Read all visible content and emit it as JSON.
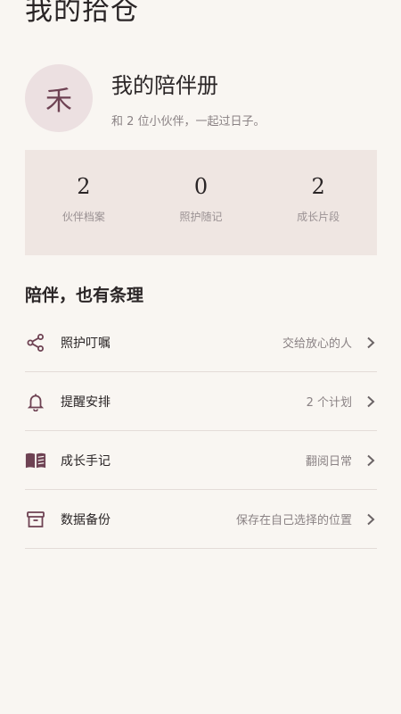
{
  "page": {
    "title": "我的拾仓"
  },
  "profile": {
    "avatar_char": "禾",
    "name": "我的陪伴册",
    "subtitle": "和 2 位小伙伴，一起过日子。"
  },
  "stats": [
    {
      "value": "2",
      "label": "伙伴档案"
    },
    {
      "value": "0",
      "label": "照护随记"
    },
    {
      "value": "2",
      "label": "成长片段"
    }
  ],
  "section": {
    "title": "陪伴，也有条理"
  },
  "menu": [
    {
      "icon": "share-icon",
      "label": "照护叮嘱",
      "value": "交给放心的人"
    },
    {
      "icon": "bell-icon",
      "label": "提醒安排",
      "value": "2 个计划"
    },
    {
      "icon": "book-icon",
      "label": "成长手记",
      "value": "翻阅日常"
    },
    {
      "icon": "archive-icon",
      "label": "数据备份",
      "value": "保存在自己选择的位置"
    }
  ],
  "colors": {
    "background": "#f9f6f2",
    "accent": "#6e4253",
    "stats_panel": "#efe6e2",
    "avatar_bg": "#ece0e1"
  }
}
